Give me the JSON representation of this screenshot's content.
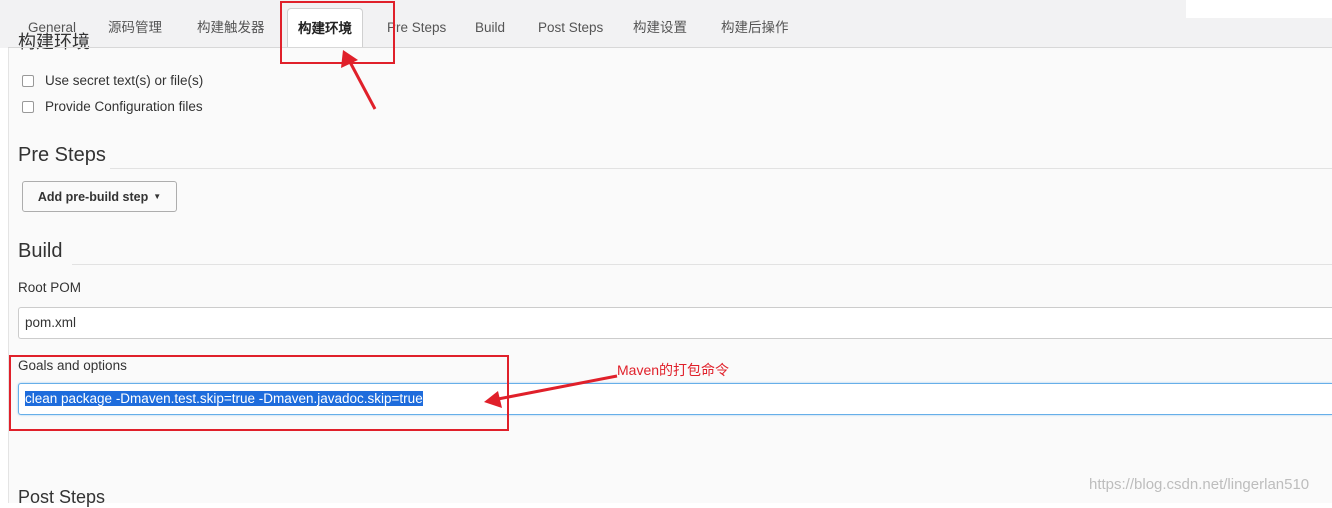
{
  "tabs": [
    {
      "label": "General"
    },
    {
      "label": "源码管理"
    },
    {
      "label": "构建触发器"
    },
    {
      "label": "构建环境"
    },
    {
      "label": "Pre Steps"
    },
    {
      "label": "Build"
    },
    {
      "label": "Post Steps"
    },
    {
      "label": "构建设置"
    },
    {
      "label": "构建后操作"
    }
  ],
  "active_tab": "构建环境",
  "build_env": {
    "heading_partial": "构建环境",
    "options": [
      {
        "label": "Use secret text(s) or file(s)",
        "checked": false
      },
      {
        "label": "Provide Configuration files",
        "checked": false
      }
    ]
  },
  "pre_steps": {
    "title": "Pre Steps",
    "add_button": "Add pre-build step"
  },
  "build": {
    "title": "Build",
    "root_pom_label": "Root POM",
    "root_pom_value": "pom.xml",
    "goals_label": "Goals and options",
    "goals_value": "clean package -Dmaven.test.skip=true -Dmaven.javadoc.skip=true"
  },
  "annotation": {
    "text": "Maven的打包命令",
    "color": "#e0202a"
  },
  "post_steps_partial": "Post Steps",
  "watermark": "https://blog.csdn.net/lingerlan510",
  "colors": {
    "accent_red": "#e0202a",
    "selection": "#1e6cdc",
    "focus_border": "#66afe9"
  }
}
